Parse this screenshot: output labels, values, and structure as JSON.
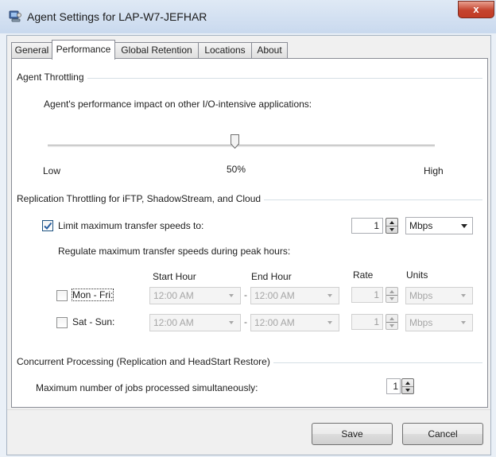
{
  "window": {
    "title": "Agent Settings for LAP-W7-JEFHAR",
    "close_label": "x"
  },
  "tabs": [
    {
      "label": "General",
      "active": false
    },
    {
      "label": "Performance",
      "active": true
    },
    {
      "label": "Global Retention",
      "active": false
    },
    {
      "label": "Locations",
      "active": false
    },
    {
      "label": "About",
      "active": false
    }
  ],
  "throttling": {
    "group_title": "Agent Throttling",
    "description": "Agent's performance impact on other I/O-intensive applications:",
    "slider_value_fraction": 0.5,
    "label_low": "Low",
    "label_mid": "50%",
    "label_high": "High"
  },
  "replication": {
    "group_title": "Replication Throttling for iFTP, ShadowStream, and Cloud",
    "limit_label": "Limit maximum transfer speeds to:",
    "limit_checked": true,
    "limit_value": "1",
    "limit_units": "Mbps",
    "peak_label": "Regulate maximum transfer speeds during peak hours:",
    "headers": {
      "start": "Start Hour",
      "end": "End Hour",
      "rate": "Rate",
      "units": "Units"
    },
    "rows": [
      {
        "label": "Mon - Fri:",
        "checked": false,
        "start": "12:00 AM",
        "end": "12:00 AM",
        "rate": "1",
        "units": "Mbps"
      },
      {
        "label": "Sat - Sun:",
        "checked": false,
        "start": "12:00 AM",
        "end": "12:00 AM",
        "rate": "1",
        "units": "Mbps"
      }
    ],
    "separator": "-"
  },
  "concurrent": {
    "group_title": "Concurrent Processing (Replication and HeadStart Restore)",
    "max_jobs_label": "Maximum number of jobs processed simultaneously:",
    "max_jobs_value": "1"
  },
  "buttons": {
    "save": "Save",
    "cancel": "Cancel"
  },
  "colors": {
    "close_button": "#c4432d",
    "panel_bg": "#ffffff",
    "client_bg": "#f0f0f0",
    "check_blue": "#2a5fa0"
  }
}
